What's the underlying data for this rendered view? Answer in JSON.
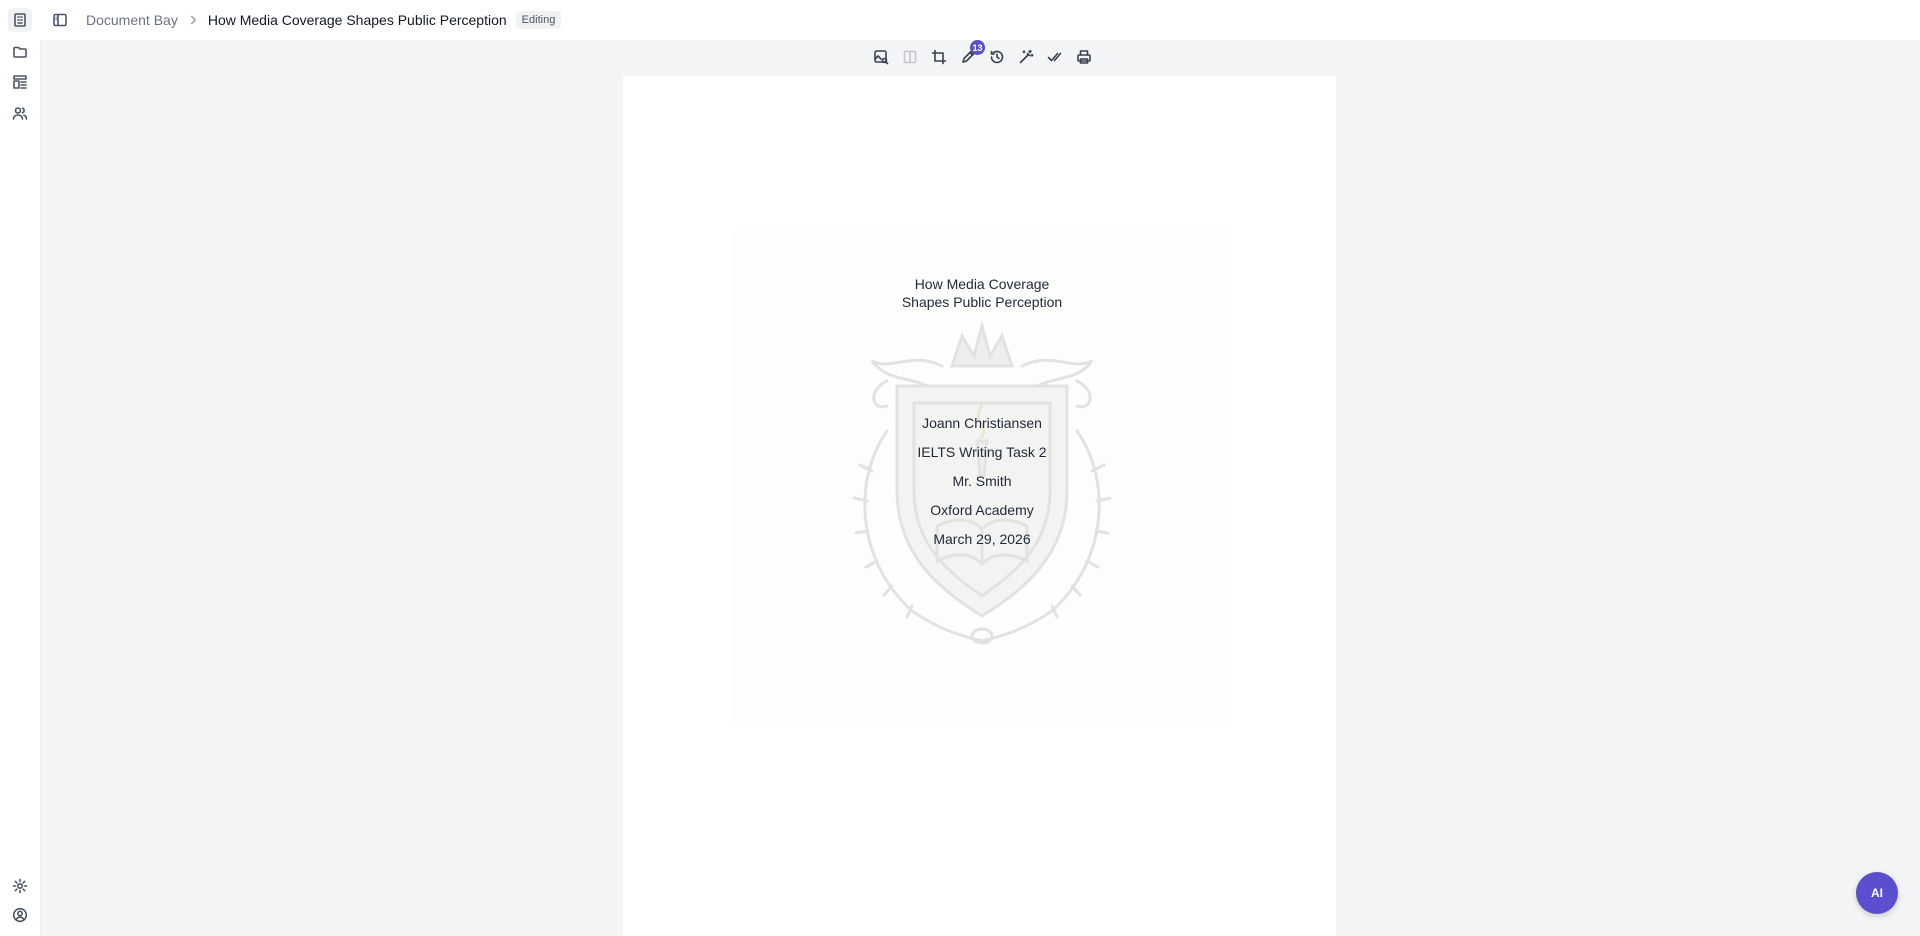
{
  "breadcrumb": {
    "root": "Document Bay",
    "current": "How Media Coverage Shapes Public Perception",
    "status": "Editing"
  },
  "sidebar": {
    "top_icons": [
      "building-icon",
      "folder-icon",
      "layout-icon",
      "users-icon"
    ],
    "bottom_icons": [
      "settings-icon",
      "user-circle-icon"
    ]
  },
  "toolbar": {
    "tools": [
      "image-search-icon",
      "columns-icon",
      "crop-icon",
      "annotate-icon",
      "history-icon",
      "magic-wand-icon",
      "check-all-icon",
      "print-icon"
    ],
    "annotation_count": "13"
  },
  "document": {
    "title_line1": "How Media Coverage",
    "title_line2": "Shapes Public Perception",
    "author": "Joann Christiansen",
    "course": "IELTS Writing Task 2",
    "instructor": "Mr. Smith",
    "institution": "Oxford Academy",
    "date": "March 29, 2026"
  },
  "assistant": {
    "label": "AI"
  },
  "colors": {
    "accent": "#5a4fcf",
    "background": "#f3f4f6"
  }
}
